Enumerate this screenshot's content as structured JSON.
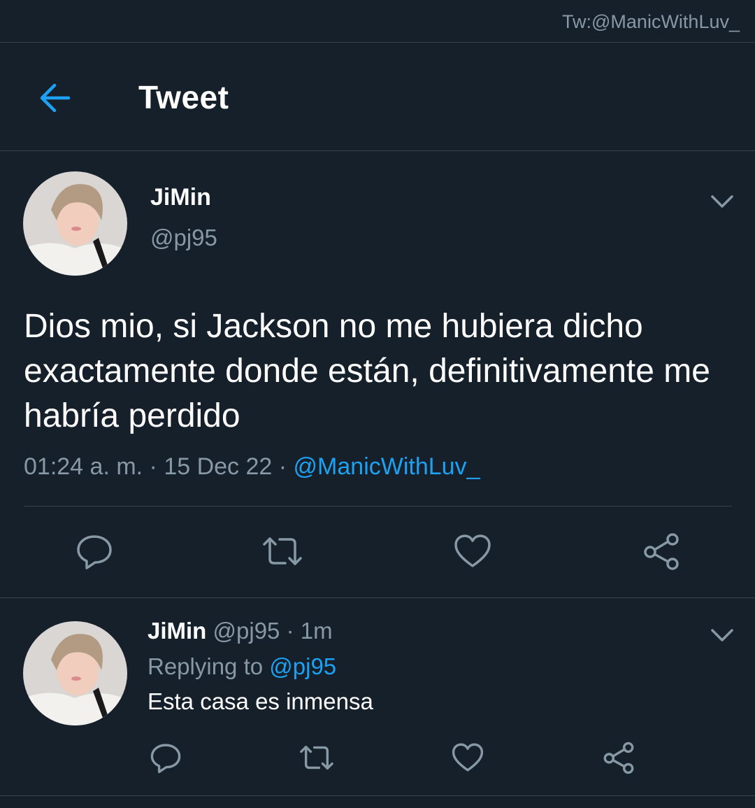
{
  "watermark": "Tw:@ManicWithLuv_",
  "header": {
    "title": "Tweet",
    "back_icon": "back-arrow-icon"
  },
  "tweet": {
    "author_name": "JiMin",
    "author_handle": "@pj95",
    "text": "Dios mio, si Jackson no me hubiera dicho exactamente donde están, definitivamente me habría perdido",
    "time": "01:24 a. m.",
    "dot1": " · ",
    "date": "15 Dec 22",
    "dot2": " · ",
    "via": "@ManicWithLuv_",
    "actions": [
      "reply-icon",
      "retweet-icon",
      "like-icon",
      "share-icon"
    ]
  },
  "reply": {
    "author_name": "JiMin",
    "author_handle": " @pj95",
    "dot": " · ",
    "age": "1m",
    "replying_to_label": "Replying to ",
    "replying_to_handle": "@pj95",
    "text": "Esta casa es inmensa"
  },
  "colors": {
    "background": "#15202b",
    "divider": "#38444d",
    "secondary_text": "#8899a6",
    "accent": "#1da1f2"
  }
}
